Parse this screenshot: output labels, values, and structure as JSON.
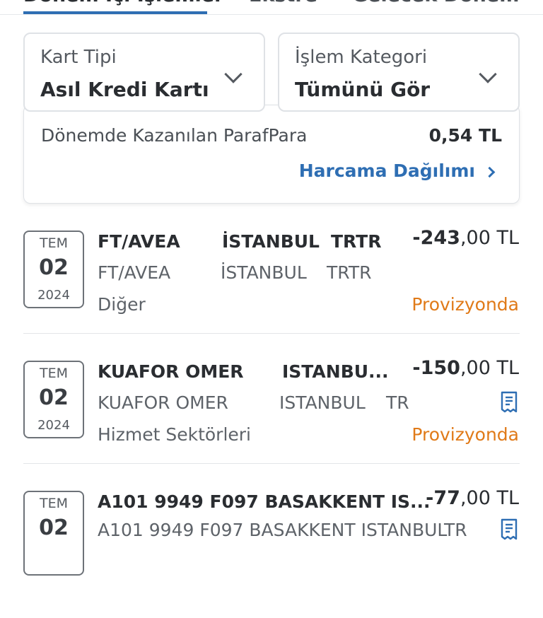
{
  "tabs": [
    {
      "label": "Dönem İçi İşlemler",
      "active": true
    },
    {
      "label": "Ekstre",
      "active": false
    },
    {
      "label": "Gelecek Dönem",
      "active": false
    }
  ],
  "filters": {
    "card_type": {
      "label": "Kart Tipi",
      "value": "Asıl Kredi Kartı"
    },
    "category": {
      "label": "İşlem Kategori",
      "value": "Tümünü Gör"
    }
  },
  "summary": {
    "label": "Dönemde Kazanılan ParafPara",
    "value": "0,54 TL",
    "link": "Harcama Dağılımı"
  },
  "transactions": [
    {
      "month": "TEM",
      "day": "02",
      "year": "2024",
      "title1": "FT/AVEA",
      "title2": "İSTANBUL",
      "title3": "TRTR",
      "sub1": "FT/AVEA",
      "sub2": "İSTANBUL",
      "sub3": "TRTR",
      "category": "Diğer",
      "amount_main": "-243",
      "amount_rest": ",00 TL",
      "status": "Provizyonda",
      "receipt": false
    },
    {
      "month": "TEM",
      "day": "02",
      "year": "2024",
      "title1": "KUAFOR OMER",
      "title2": "ISTANBU...",
      "title3": "",
      "sub1": "KUAFOR OMER",
      "sub2": "ISTANBUL",
      "sub3": "TR",
      "category": "Hizmet Sektörleri",
      "amount_main": "-150",
      "amount_rest": ",00 TL",
      "status": "Provizyonda",
      "receipt": true
    },
    {
      "month": "TEM",
      "day": "02",
      "year": "",
      "title1": "A101 9949 F097 BASAKKENT IS...",
      "title2": "",
      "title3": "",
      "sub1": "A101 9949 F097 BASAKKENT ISTANBUL",
      "sub2": "",
      "sub3": "TR",
      "category": "",
      "amount_main": "-77",
      "amount_rest": ",00 TL",
      "status": "",
      "receipt": true
    }
  ],
  "colors": {
    "accent": "#2e6eb3",
    "status": "#e07a18"
  },
  "icons": {
    "dropdown": "chevron-down-icon",
    "link": "chevron-right-icon",
    "receipt": "receipt-icon"
  }
}
